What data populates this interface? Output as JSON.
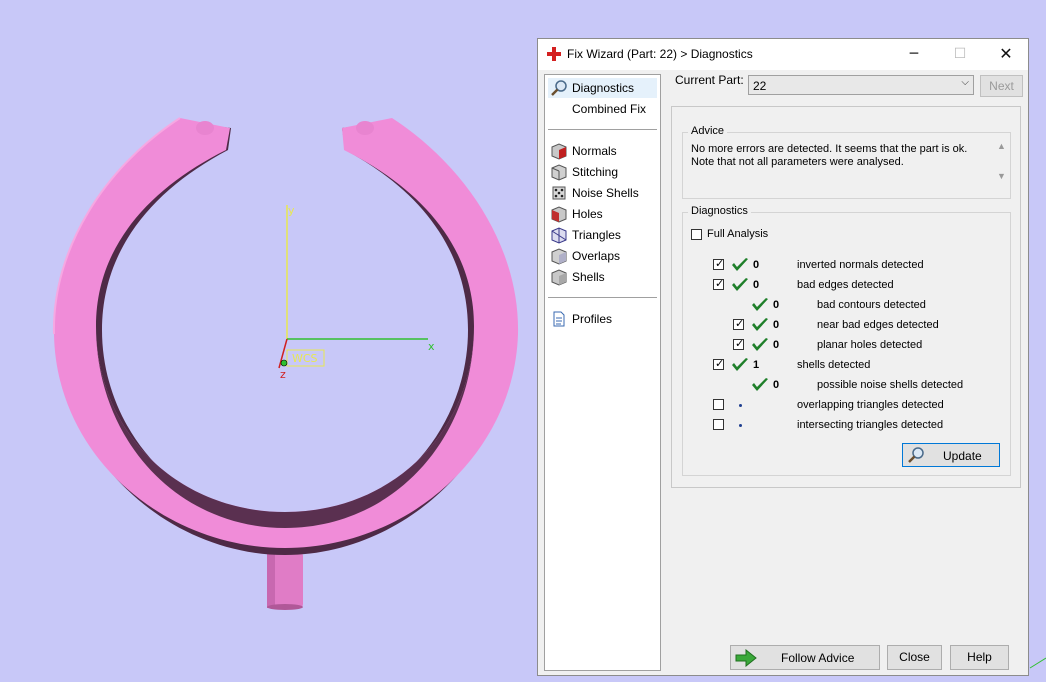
{
  "viewport": {
    "axis_x": "x",
    "axis_y": "y",
    "axis_z": "z",
    "wcs_label": "WCS",
    "colors": {
      "background": "#c8c8f8",
      "ring": "#f08cd8",
      "ring_shadow": "#5a3050"
    }
  },
  "dialog": {
    "title": "Fix Wizard (Part: 22) > Diagnostics",
    "window_controls": {
      "minimize": "─",
      "maximize": "☐",
      "close": "✕"
    },
    "nav": {
      "diagnostics": "Diagnostics",
      "combined_fix": "Combined Fix",
      "normals": "Normals",
      "stitching": "Stitching",
      "noise_shells": "Noise Shells",
      "holes": "Holes",
      "triangles": "Triangles",
      "overlaps": "Overlaps",
      "shells": "Shells",
      "profiles": "Profiles"
    },
    "current_part_label": "Current Part:",
    "current_part_value": "22",
    "next_label": "Next",
    "advice": {
      "title": "Advice",
      "line1": "No more errors are detected. It seems that the part is ok.",
      "line2": "Note that not all parameters were analysed."
    },
    "diagnostics": {
      "title": "Diagnostics",
      "full_analysis": "Full Analysis",
      "rows": [
        {
          "checked": true,
          "status": "ok",
          "count": "0",
          "label": "inverted normals detected"
        },
        {
          "checked": true,
          "status": "ok",
          "count": "0",
          "label": "bad edges detected"
        },
        {
          "checked": null,
          "status": "ok",
          "count": "0",
          "label": "bad contours detected"
        },
        {
          "checked": true,
          "status": "ok",
          "count": "0",
          "label": "near bad edges detected"
        },
        {
          "checked": true,
          "status": "ok",
          "count": "0",
          "label": "planar holes detected"
        },
        {
          "checked": true,
          "status": "ok",
          "count": "1",
          "label": "shells detected"
        },
        {
          "checked": null,
          "status": "ok",
          "count": "0",
          "label": "possible noise shells detected"
        },
        {
          "checked": false,
          "status": "pending",
          "count": "",
          "label": "overlapping triangles detected"
        },
        {
          "checked": false,
          "status": "pending",
          "count": "",
          "label": "intersecting triangles detected"
        }
      ]
    },
    "update_label": "Update",
    "follow_advice_label": "Follow Advice",
    "close_label": "Close",
    "help_label": "Help"
  }
}
